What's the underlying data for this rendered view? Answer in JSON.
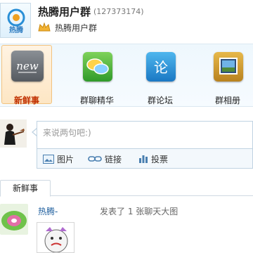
{
  "header": {
    "group_name": "热腾用户群",
    "group_number": "(127373174)",
    "group_subname": "热腾用户群",
    "avatar_logo_text": "热腾"
  },
  "nav": {
    "items": [
      {
        "label": "新鲜事",
        "icon": "new-icon",
        "selected": true,
        "tile_text": "new"
      },
      {
        "label": "群聊精华",
        "icon": "chat-bubbles-icon",
        "selected": false
      },
      {
        "label": "群论坛",
        "icon": "forum-icon",
        "selected": false,
        "tile_text": "论"
      },
      {
        "label": "群相册",
        "icon": "album-icon",
        "selected": false
      }
    ]
  },
  "composer": {
    "placeholder": "来说两句吧:)",
    "tools": [
      {
        "label": "图片",
        "icon": "image-icon"
      },
      {
        "label": "链接",
        "icon": "link-icon"
      },
      {
        "label": "投票",
        "icon": "vote-icon"
      }
    ]
  },
  "feed": {
    "tabs": [
      {
        "label": "新鲜事",
        "active": true
      }
    ],
    "items": [
      {
        "author": "热腾-",
        "action": "发表了 1 张聊天大图"
      }
    ]
  },
  "colors": {
    "accent_blue": "#1f5f9e",
    "nav_band": "#eef7fd",
    "selected_orange": "#f2c27e"
  }
}
